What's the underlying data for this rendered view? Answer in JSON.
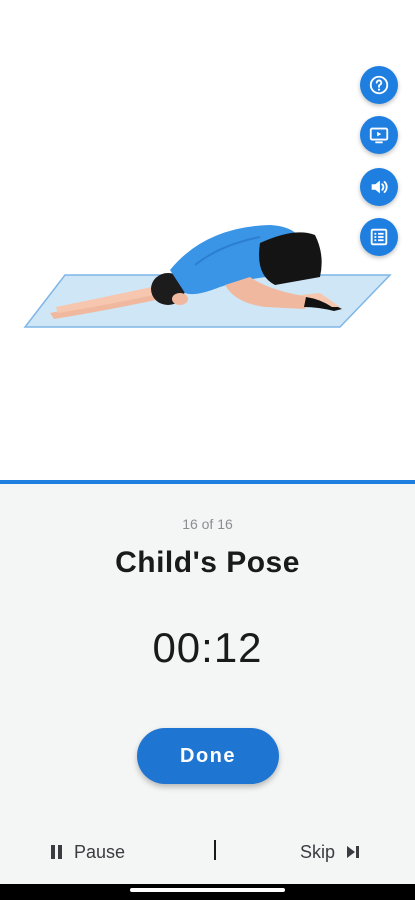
{
  "exercise": {
    "counter": "16 of 16",
    "name": "Child's Pose",
    "timer": "00:12",
    "progress_fraction": 1.0
  },
  "side_buttons": [
    {
      "icon": "help-icon"
    },
    {
      "icon": "video-icon"
    },
    {
      "icon": "sound-icon"
    },
    {
      "icon": "list-icon"
    }
  ],
  "actions": {
    "done_label": "Done",
    "pause_label": "Pause",
    "skip_label": "Skip"
  },
  "colors": {
    "accent": "#1f7fe0",
    "button": "#1f76d2",
    "panel_bg": "#f4f5f5"
  }
}
